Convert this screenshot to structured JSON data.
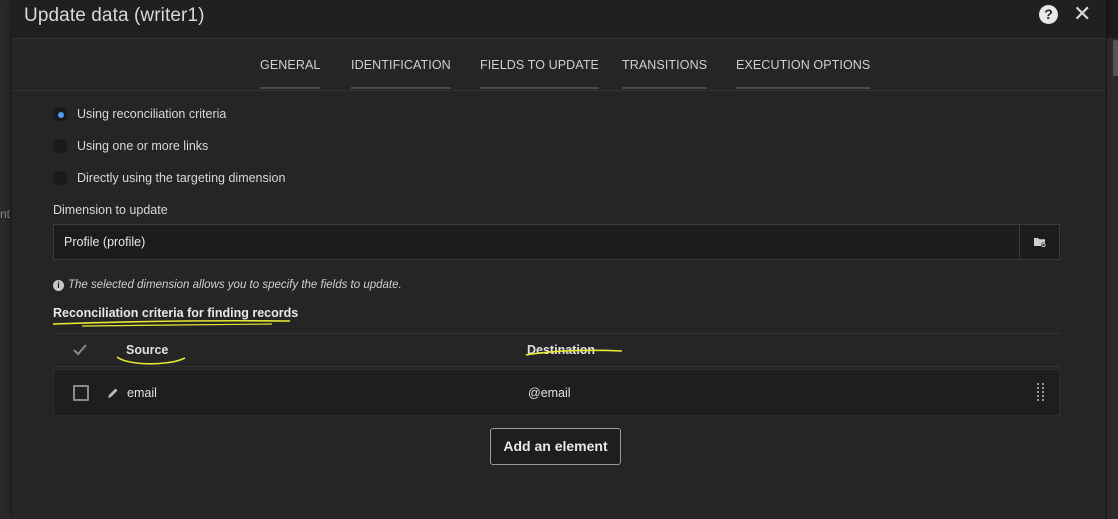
{
  "background": {
    "fragment_text": "nt"
  },
  "dialog": {
    "title": "Update data (writer1)",
    "help_icon_glyph": "?",
    "close_icon_glyph": "✕"
  },
  "tabs": [
    {
      "label": "GENERAL"
    },
    {
      "label": "IDENTIFICATION"
    },
    {
      "label": "FIELDS TO UPDATE"
    },
    {
      "label": "TRANSITIONS"
    },
    {
      "label": "EXECUTION OPTIONS"
    }
  ],
  "identification": {
    "options": [
      {
        "label": "Using reconciliation criteria",
        "selected": true
      },
      {
        "label": "Using one or more links",
        "selected": false
      },
      {
        "label": "Directly using the targeting dimension",
        "selected": false
      }
    ],
    "dimension_label": "Dimension to update",
    "dimension_value": "Profile (profile)",
    "info_icon_glyph": "i",
    "info_text": "The selected dimension allows you to specify the fields to update.",
    "criteria_title": "Reconciliation criteria for finding records",
    "table": {
      "headers": {
        "source": "Source",
        "destination": "Destination"
      },
      "rows": [
        {
          "source": "email",
          "destination": "@email",
          "checked": false
        }
      ]
    },
    "add_button_label": "Add an element"
  },
  "colors": {
    "accent": "#4b9cf5",
    "annotation": "#e8e832",
    "dialog_bg": "#252525",
    "input_bg": "#1c1c1c"
  },
  "icons": {
    "help": "help-icon",
    "close": "close-icon",
    "browse": "folder-browse-icon",
    "check_all": "checkmark-icon",
    "edit": "pencil-icon",
    "drag": "drag-handle-icon",
    "info": "info-icon"
  }
}
